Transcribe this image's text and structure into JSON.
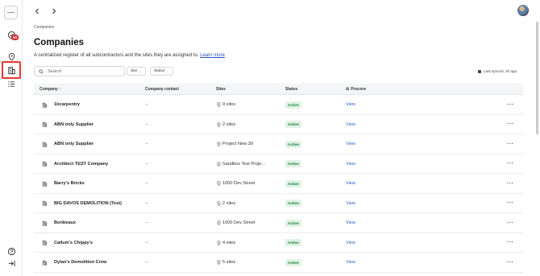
{
  "breadcrumb": "Companies",
  "title": "Companies",
  "subtitle": "A centralized register of all subcontractors and the sites they are assigned to.",
  "learn_more": "Learn more",
  "badge": "50",
  "search": {
    "placeholder": "Search"
  },
  "filters": {
    "site": "Site",
    "status": "Status"
  },
  "sync": "Last synced: 2h ago",
  "columns": {
    "company": "Company",
    "contact": "Company contact",
    "sites": "Sites",
    "status": "Status",
    "procore": "Procore"
  },
  "rows": [
    {
      "name": "1bcarpentry",
      "contact": "--",
      "sites": "9 sites",
      "status": "Active",
      "procore": "View"
    },
    {
      "name": "ABN only Supplier",
      "contact": "--",
      "sites": "2 sites",
      "status": "Active",
      "procore": "View"
    },
    {
      "name": "ABN only Supplier",
      "contact": "--",
      "sites": "Project New 39",
      "status": "Active",
      "procore": "View"
    },
    {
      "name": "Architect TEST Company",
      "contact": "--",
      "sites": "Sandbox Test Proje...",
      "status": "Active",
      "procore": "View"
    },
    {
      "name": "Barry's Bricks",
      "contact": "--",
      "sites": "1000 Dev Street",
      "status": "Active",
      "procore": "View"
    },
    {
      "name": "BIG DAVOS DEMOLITION (Test)",
      "contact": "--",
      "sites": "2 sites",
      "status": "Active",
      "procore": "View"
    },
    {
      "name": "Bonbeaux",
      "contact": "--",
      "sites": "1000 Dev Street",
      "status": "Active",
      "procore": "View"
    },
    {
      "name": "Callum's Chippy's",
      "contact": "--",
      "sites": "4 sites",
      "status": "Active",
      "procore": "View"
    },
    {
      "name": "Dylan's Demolition Crew",
      "contact": "--",
      "sites": "5 sites",
      "status": "Active",
      "procore": "View"
    }
  ],
  "more_glyph": "···",
  "colors": {
    "accent": "#2a62c9",
    "active_bg": "#dff3e4",
    "active_text": "#1f7a3a",
    "highlight": "#e53935"
  }
}
